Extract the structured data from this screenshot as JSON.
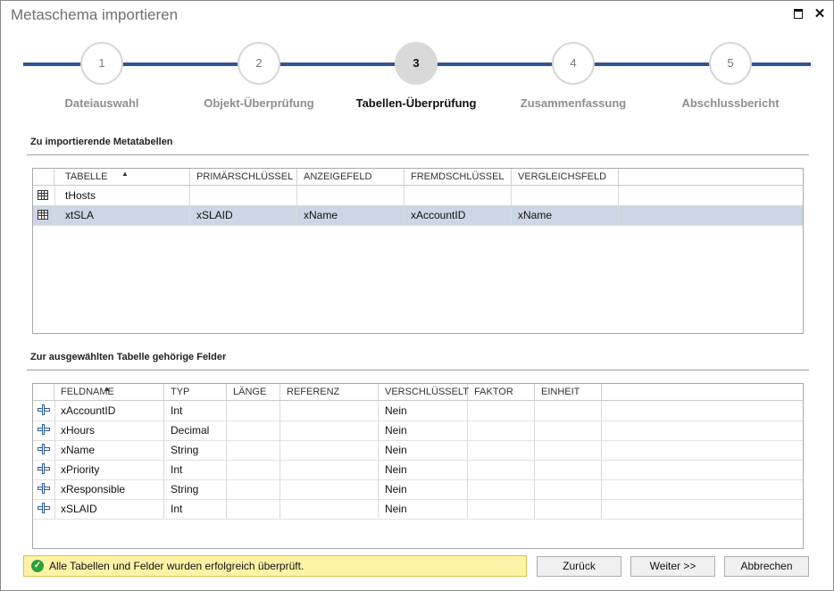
{
  "window": {
    "title": "Metaschema importieren"
  },
  "wizard": {
    "steps": [
      {
        "number": "1",
        "label": "Dateiauswahl"
      },
      {
        "number": "2",
        "label": "Objekt-Überprüfung"
      },
      {
        "number": "3",
        "label": "Tabellen-Überprüfung"
      },
      {
        "number": "4",
        "label": "Zusammenfassung"
      },
      {
        "number": "5",
        "label": "Abschlussbericht"
      }
    ],
    "active_step": "3"
  },
  "tables_section": {
    "title": "Zu importierende Metatabellen",
    "columns": [
      "TABELLE",
      "PRIMÄRSCHLÜSSEL",
      "ANZEIGEFELD",
      "FREMDSCHLÜSSEL",
      "VERGLEICHSFELD"
    ],
    "rows": [
      {
        "icon": "table-icon",
        "cells": [
          "tHosts",
          "",
          "",
          "",
          ""
        ]
      },
      {
        "icon": "table-icon",
        "cells": [
          "xtSLA",
          "xSLAID",
          "xName",
          "xAccountID",
          "xName"
        ],
        "selected": true
      }
    ]
  },
  "fields_section": {
    "title": "Zur ausgewählten Tabelle gehörige Felder",
    "columns": [
      "FELDNAME",
      "TYP",
      "LÄNGE",
      "REFERENZ",
      "VERSCHLÜSSELT",
      "FAKTOR",
      "EINHEIT"
    ],
    "rows": [
      {
        "icon": "field-icon",
        "cells": [
          "xAccountID",
          "Int",
          "",
          "",
          "Nein",
          "",
          ""
        ]
      },
      {
        "icon": "field-icon",
        "cells": [
          "xHours",
          "Decimal",
          "",
          "",
          "Nein",
          "",
          ""
        ]
      },
      {
        "icon": "field-icon",
        "cells": [
          "xName",
          "String",
          "",
          "",
          "Nein",
          "",
          ""
        ]
      },
      {
        "icon": "field-icon",
        "cells": [
          "xPriority",
          "Int",
          "",
          "",
          "Nein",
          "",
          ""
        ]
      },
      {
        "icon": "field-icon",
        "cells": [
          "xResponsible",
          "String",
          "",
          "",
          "Nein",
          "",
          ""
        ]
      },
      {
        "icon": "field-icon",
        "cells": [
          "xSLAID",
          "Int",
          "",
          "",
          "Nein",
          "",
          ""
        ]
      }
    ]
  },
  "status": {
    "icon": "check-circle-icon",
    "message": "Alle Tabellen und Felder wurden erfolgreich überprüft.",
    "color": "#fdf3a6"
  },
  "buttons": {
    "back": "Zurück",
    "next": "Weiter >>",
    "cancel": "Abbrechen"
  },
  "colors": {
    "accent": "#2f5597",
    "selection": "#ccd6e6",
    "success": "#2e9e3a"
  }
}
